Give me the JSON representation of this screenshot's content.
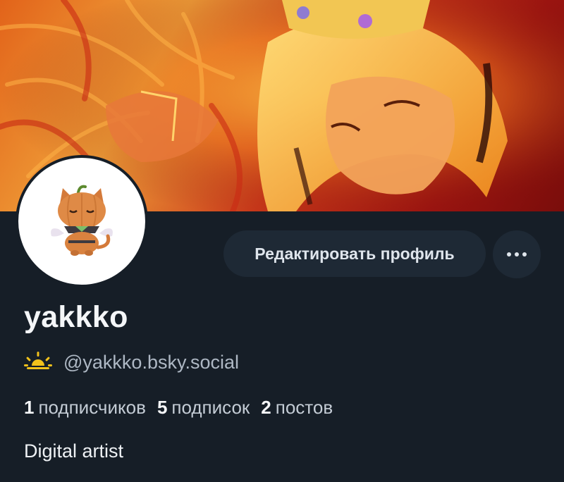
{
  "profile": {
    "display_name": "yakkko",
    "handle": "@yakkko.bsky.social",
    "bio": "Digital artist",
    "stats": [
      {
        "count": "1",
        "label": "подписчиков"
      },
      {
        "count": "5",
        "label": "подписок"
      },
      {
        "count": "2",
        "label": "постов"
      }
    ]
  },
  "actions": {
    "edit_label": "Редактировать профиль",
    "more_icon": "ellipsis-icon"
  },
  "icons": {
    "handle_badge": "sun-icon",
    "avatar": "pumpkin-cat-avatar"
  },
  "colors": {
    "background": "#161e27",
    "button_bg": "#1e2935",
    "banner_main": "#e2631a",
    "sun_yellow": "#f2c21b"
  }
}
